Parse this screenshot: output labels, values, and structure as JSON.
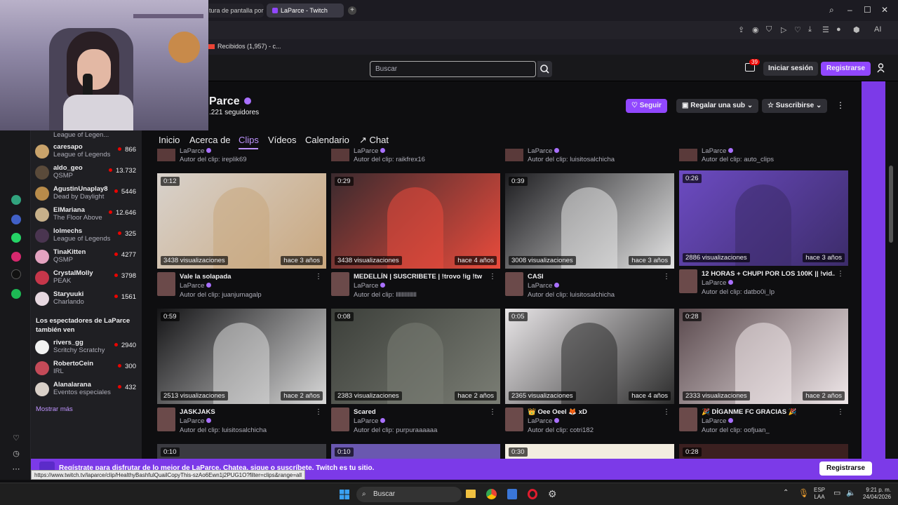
{
  "browser": {
    "tabs": [
      {
        "label": "tura de pantalla por L"
      },
      {
        "label": "LaParce - Twitch"
      }
    ],
    "bookmark": "Recibidos (1,957) - c..."
  },
  "twitch": {
    "search_placeholder": "Buscar",
    "notif_count": "39",
    "login_label": "Iniciar sesión",
    "register_label": "Registrarse"
  },
  "channel": {
    "name": "Parce",
    "followers": ".221 seguidores",
    "follow_label": "Seguir",
    "gift_label": "Regalar una sub",
    "subscribe_label": "Suscribirse",
    "tabs": [
      "Inicio",
      "Acerca de",
      "Clips",
      "Vídeos",
      "Calendario",
      "Chat"
    ],
    "active_tab": "Clips"
  },
  "sidebar": {
    "partial_top_game": "League of Legen...",
    "channels": [
      {
        "name": "caresapo",
        "game": "League of Legends",
        "viewers": "866",
        "color": "#c9a36b"
      },
      {
        "name": "aldo_geo",
        "game": "QSMP",
        "viewers": "13.732",
        "color": "#5a4a3a"
      },
      {
        "name": "AgustinUnaplay8",
        "game": "Dead by Daylight",
        "viewers": "5446",
        "color": "#b88b4a"
      },
      {
        "name": "ElMariana",
        "game": "The Floor Above",
        "viewers": "12.646",
        "color": "#c7b08a"
      },
      {
        "name": "lolmechs",
        "game": "League of Legends",
        "viewers": "325",
        "color": "#4a3550"
      },
      {
        "name": "TinaKitten",
        "game": "QSMP",
        "viewers": "4277",
        "color": "#e4a3c0"
      },
      {
        "name": "CrystalMolly",
        "game": "PEAK",
        "viewers": "3798",
        "color": "#c6364a"
      },
      {
        "name": "Staryuuki",
        "game": "Charlando",
        "viewers": "1561",
        "color": "#e7d8e0"
      }
    ],
    "viewers_also_watch": "Los espectadores de LaParce también ven",
    "also_channels": [
      {
        "name": "rivers_gg",
        "game": "Scritchy Scratchy",
        "viewers": "2940",
        "color": "#f2f2f2"
      },
      {
        "name": "RobertoCein",
        "game": "IRL",
        "viewers": "300",
        "color": "#c44a58"
      },
      {
        "name": "Alanalarana",
        "game": "Eventos especiales",
        "viewers": "432",
        "color": "#d9d0c8"
      }
    ],
    "show_more": "Mostrar más"
  },
  "partial_row": [
    {
      "channel": "LaParce",
      "author": "Autor del clip: ireplik69"
    },
    {
      "channel": "LaParce",
      "author": "Autor del clip: raikfrex16"
    },
    {
      "channel": "LaParce",
      "author": "Autor del clip: luisitosalchicha"
    },
    {
      "channel": "LaParce",
      "author": "Autor del clip: auto_clips"
    }
  ],
  "clips": [
    {
      "duration": "0:12",
      "views": "3438 visualizaciones",
      "ago": "hace 3 años",
      "title": "Vale la solapada",
      "channel": "LaParce",
      "author": "Autor del clip: juanjumagalp",
      "bg": "#d8d2cc",
      "accent": "#c9a77e"
    },
    {
      "duration": "0:29",
      "views": "3438 visualizaciones",
      "ago": "hace 4 años",
      "title": "MEDELLÍN | SUSCRIBETE | !trovo !ig !tw",
      "channel": "LaParce",
      "author": "Autor del clip: llllllllllllll",
      "bg": "#3a2a2e",
      "accent": "#e94b3c"
    },
    {
      "duration": "0:39",
      "views": "3008 visualizaciones",
      "ago": "hace 3 años",
      "title": "CASI",
      "channel": "LaParce",
      "author": "Autor del clip: luisitosalchicha",
      "bg": "#1d1d20",
      "accent": "#e4e4e4"
    },
    {
      "duration": "0:26",
      "views": "2886 visualizaciones",
      "ago": "hace 3 años",
      "title": "12 HORAS + CHUPI POR LOS 100K || !vid...",
      "channel": "LaParce",
      "author": "Autor del clip: datbo0i_lp",
      "bg": "#6c4bc2",
      "accent": "#3c2c6a"
    },
    {
      "duration": "0:59",
      "views": "2513 visualizaciones",
      "ago": "hace 2 años",
      "title": "JASKJAKS",
      "channel": "LaParce",
      "author": "Autor del clip: luisitosalchicha",
      "bg": "#141416",
      "accent": "#d8d8d8"
    },
    {
      "duration": "0:08",
      "views": "2383 visualizaciones",
      "ago": "hace 2 años",
      "title": "Scared",
      "channel": "LaParce",
      "author": "Autor del clip: purpuraaaaaa",
      "bg": "#3c3f3a",
      "accent": "#7a7d74"
    },
    {
      "duration": "0:05",
      "views": "2365 visualizaciones",
      "ago": "hace 4 años",
      "title": "👑 Oee Oeel 🦊 xD",
      "channel": "LaParce",
      "author": "Autor del clip: cotri182",
      "bg": "#e9e6e8",
      "accent": "#2c2c2c"
    },
    {
      "duration": "0:28",
      "views": "2333 visualizaciones",
      "ago": "hace 2 años",
      "title": "🎉 DÍGANME FC GRACIAS 🎉",
      "channel": "LaParce",
      "author": "Autor del clip: oofjuan_",
      "bg": "#5b4a4e",
      "accent": "#f0e8ea"
    }
  ],
  "next_row_durations": [
    "0:10",
    "0:10",
    "0:30",
    "0:28"
  ],
  "banner": {
    "text": "Regístrate para disfrutar de lo mejor de LaParce. Chatea, sigue o suscríbete. Twitch es tu sitio.",
    "button": "Registrarse"
  },
  "status_url": "https://www.twitch.tv/laparce/clip/HealthyBashfulQuailCopyThis-szAo6Ewn1j2PUG1O?filter=clips&range=all",
  "taskbar": {
    "search": "Buscar",
    "lang_top": "ESP",
    "lang_bottom": "LAA",
    "time": "9:21 p. m.",
    "date": "24/04/2026"
  },
  "colors": {
    "accent": "#9147ff",
    "live": "#eb0400"
  }
}
